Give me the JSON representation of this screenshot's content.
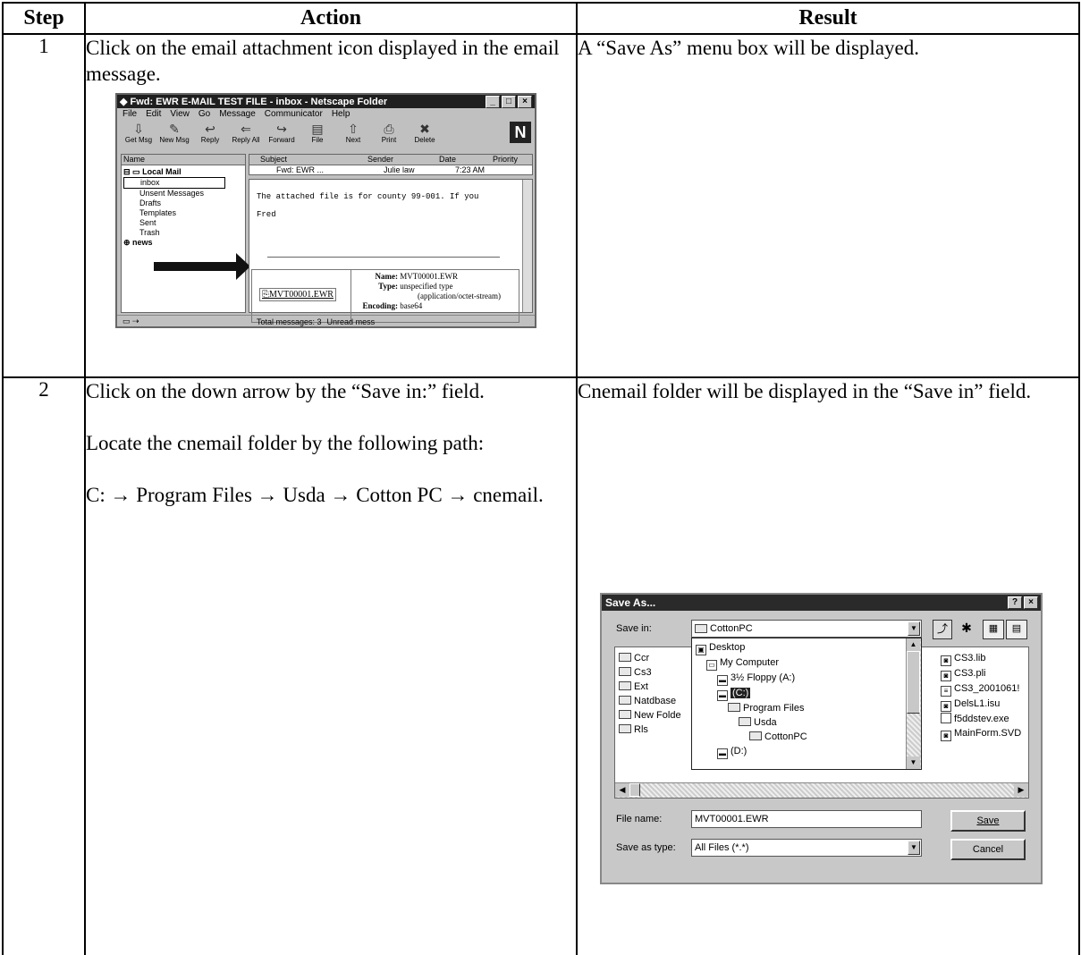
{
  "headers": {
    "step": "Step",
    "action": "Action",
    "result": "Result"
  },
  "rows": [
    {
      "step": "1",
      "action": [
        "Click on the email attachment icon displayed in the email message."
      ],
      "result": "A “Save As” menu box will be displayed."
    },
    {
      "step": "2",
      "action": [
        "Click on the down arrow by the “Save in:” field.",
        "Locate the cnemail folder by the following path:",
        "C: → Program Files → Usda → Cotton PC → cnemail."
      ],
      "result": "Cnemail folder will be displayed in the “Save in” field."
    }
  ],
  "netscape": {
    "title": "Fwd: EWR E-MAIL TEST FILE - inbox - Netscape Folder",
    "menu": [
      "File",
      "Edit",
      "View",
      "Go",
      "Message",
      "Communicator",
      "Help"
    ],
    "toolbar": [
      "Get Msg",
      "New Msg",
      "Reply",
      "Reply All",
      "Forward",
      "File",
      "Next",
      "Print",
      "Delete"
    ],
    "columns": {
      "name": "Name",
      "subject": "Subject",
      "sender": "Sender",
      "date": "Date",
      "priority": "Priority"
    },
    "folders": [
      "Local Mail",
      "inbox",
      "Unsent Messages",
      "Drafts",
      "Templates",
      "Sent",
      "Trash",
      "news"
    ],
    "message_row": {
      "subject": "Fwd: EWR ...",
      "sender": "Julie law",
      "date": "7:23 AM"
    },
    "body_line1": "The attached file is for county 99-001.  If you",
    "body_line2": "Fred",
    "attachment": {
      "link": "MVT00001.EWR",
      "name_label": "Name:",
      "name_value": "MVT00001.EWR",
      "type_label": "Type:",
      "type_value": "unspecified type",
      "type_value2": "(application/octet-stream)",
      "encoding_label": "Encoding:",
      "encoding_value": "base64"
    },
    "status": {
      "total": "Total messages: 3",
      "unread": "Unread mess"
    }
  },
  "save_as": {
    "title": "Save As...",
    "help": "?",
    "close": "×",
    "save_in_label": "Save in:",
    "save_in_value": "CottonPC",
    "left_files": [
      "Ccr",
      "Cs3",
      "Ext",
      "Natdbase",
      "New Folde",
      "Rls"
    ],
    "dropdown": [
      "Desktop",
      "My Computer",
      "3½ Floppy (A:)",
      "(C:)",
      "Program Files",
      "Usda",
      "CottonPC",
      "(D:)"
    ],
    "right_files": [
      "CS3.lib",
      "CS3.pli",
      "CS3_2001061!",
      "DelsL1.isu",
      "f5ddstev.exe",
      "MainForm.SVD"
    ],
    "file_name_label": "File name:",
    "file_name_value": "MVT00001.EWR",
    "save_type_label": "Save as type:",
    "save_type_value": "All Files (*.*)",
    "save_button": "Save",
    "cancel_button": "Cancel"
  }
}
